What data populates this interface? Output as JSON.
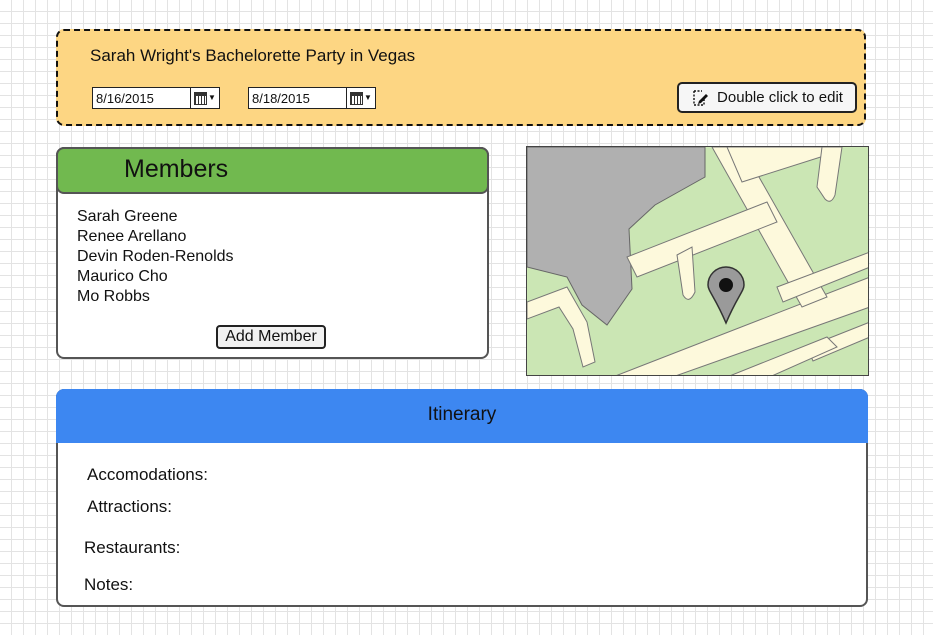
{
  "trip": {
    "title": "Sarah Wright's Bachelorette Party in Vegas",
    "start_date": "8/16/2015",
    "end_date": "8/18/2015",
    "edit_label": "Double click to edit"
  },
  "members": {
    "title": "Members",
    "items": [
      "Sarah Greene",
      "Renee Arellano",
      "Devin Roden-Renolds",
      "Maurico Cho",
      "Mo Robbs"
    ],
    "add_label": "Add Member"
  },
  "map": {
    "icon": "map-pin-icon"
  },
  "itinerary": {
    "title": "Itinerary",
    "labels": {
      "accomodations": "Accomodations:",
      "attractions": "Attractions:",
      "restaurants": "Restaurants:",
      "notes": "Notes:"
    }
  },
  "colors": {
    "trip_panel_bg": "#fdd683",
    "members_header_bg": "#71b94f",
    "itinerary_header_bg": "#3d87f1",
    "map_park": "#cbe6b4",
    "map_road": "#fdf9dc",
    "map_building": "#b0b0b0"
  }
}
